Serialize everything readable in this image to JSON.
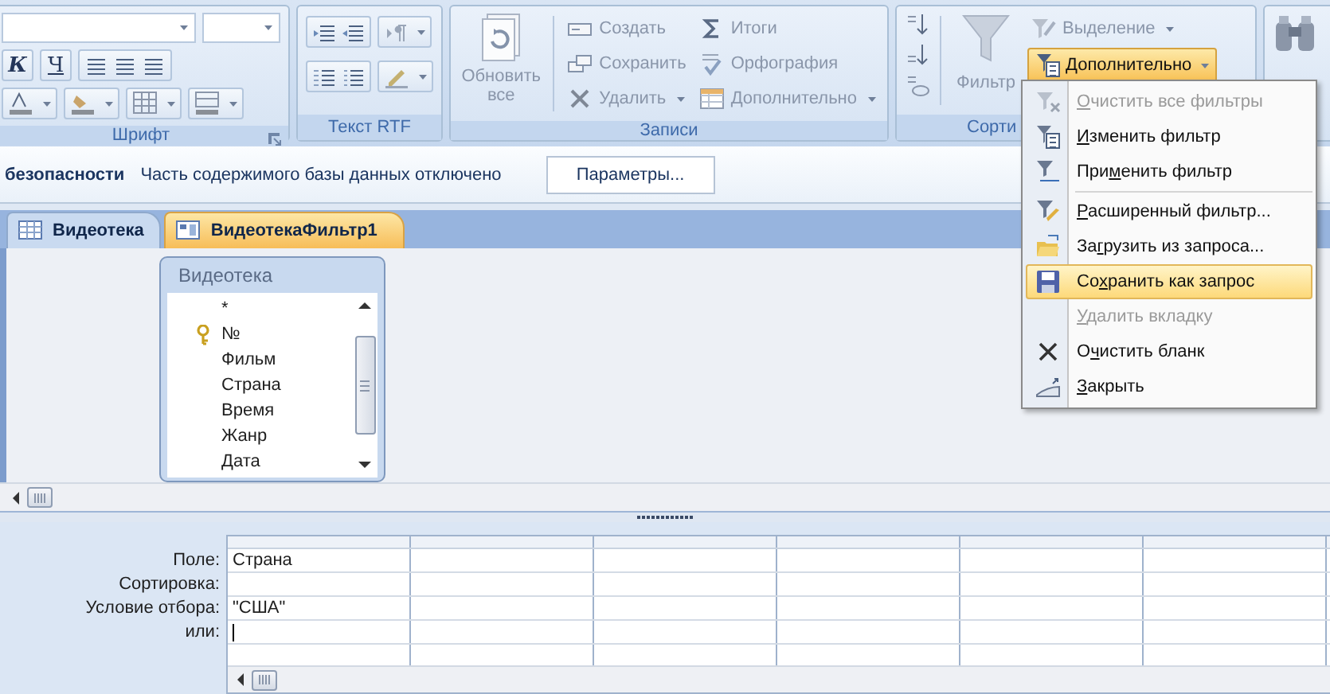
{
  "ribbon": {
    "groups": [
      {
        "kind": "font",
        "label": "Шрифт",
        "buttons": [
          {
            "text": "К",
            "disabled": false
          },
          {
            "text": "Ч",
            "disabled": false
          }
        ]
      },
      {
        "kind": "rtf",
        "label": "Текст RTF"
      },
      {
        "kind": "records",
        "label": "Записи",
        "refresh": {
          "text": "Обновить все",
          "disabled": true
        },
        "buttons": [
          {
            "text": "Создать",
            "disabled": true
          },
          {
            "text": "Сохранить",
            "disabled": true
          },
          {
            "text": "Удалить",
            "disabled": true
          },
          {
            "text": "Итоги",
            "disabled": true
          },
          {
            "text": "Орфография",
            "disabled": true
          },
          {
            "text": "Дополнительно",
            "disabled": true
          }
        ]
      },
      {
        "kind": "sort",
        "label": "Сорти",
        "filter": {
          "text": "Фильтр",
          "disabled": true
        },
        "selection": {
          "text": "Выделение",
          "disabled": true
        },
        "advanced": {
          "text": "Дополнительно",
          "selected": true
        }
      },
      {
        "kind": "find"
      }
    ]
  },
  "security_bar": {
    "title": "безопасности",
    "message": "Часть содержимого базы данных отключено",
    "button": "Параметры..."
  },
  "tabs": [
    {
      "label": "Видеотека",
      "kind": "table",
      "selected": false
    },
    {
      "label": "ВидеотекаФильтр1",
      "kind": "filter",
      "selected": true
    }
  ],
  "field_list": {
    "title": "Видеотека",
    "fields": [
      {
        "name": "*",
        "key": false
      },
      {
        "name": "№",
        "key": true
      },
      {
        "name": "Фильм",
        "key": false
      },
      {
        "name": "Страна",
        "key": false
      },
      {
        "name": "Время",
        "key": false
      },
      {
        "name": "Жанр",
        "key": false
      },
      {
        "name": "Дата",
        "key": false
      }
    ]
  },
  "grid": {
    "rows": [
      {
        "label": "Поле:",
        "cells": [
          "Страна"
        ],
        "cursor": false
      },
      {
        "label": "Сортировка:",
        "cursor": false
      },
      {
        "label": "Условие отбора:",
        "cells": [
          "\"США\""
        ],
        "cursor": false
      },
      {
        "label": "или:",
        "cursor": true
      }
    ]
  },
  "menu": {
    "items": [
      {
        "key": "О",
        "post": "чистить все фильтры",
        "disabled": true,
        "selected": false,
        "separator_after": false
      },
      {
        "key": "И",
        "post": "зменить фильтр",
        "disabled": false,
        "selected": false,
        "separator_after": false
      },
      {
        "pre": "При",
        "key": "м",
        "post": "енить фильтр",
        "disabled": false,
        "selected": false,
        "separator_after": true
      },
      {
        "key": "Р",
        "post": "асширенный фильтр...",
        "disabled": false,
        "selected": false,
        "separator_after": false
      },
      {
        "pre": "За",
        "key": "г",
        "post": "рузить из запроса...",
        "disabled": false,
        "selected": false,
        "separator_after": false
      },
      {
        "pre": "Со",
        "key": "х",
        "post": "ранить как запрос",
        "disabled": false,
        "selected": true,
        "separator_after": false
      },
      {
        "key": "У",
        "post": "далить вкладку",
        "disabled": true,
        "selected": false,
        "separator_after": false
      },
      {
        "pre": "О",
        "key": "ч",
        "post": "истить бланк",
        "disabled": false,
        "selected": false,
        "separator_after": false
      },
      {
        "key": "З",
        "post": "акрыть",
        "disabled": false,
        "selected": false,
        "separator_after": false
      }
    ]
  }
}
